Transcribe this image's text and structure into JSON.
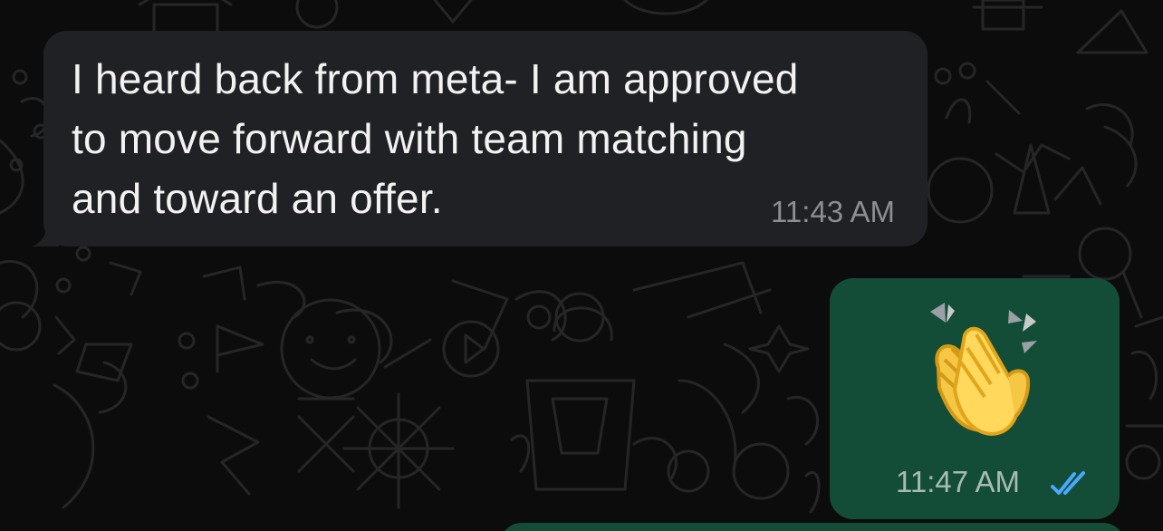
{
  "chat": {
    "messages": [
      {
        "direction": "incoming",
        "text": "I heard back from meta- I am approved\nto move forward with team matching\nand toward an offer.",
        "time": "11:43 AM"
      },
      {
        "direction": "outgoing",
        "emoji": "clapping-hands-emoji",
        "time": "11:47 AM",
        "status": "read",
        "status_icon": "double-check-icon"
      }
    ],
    "colors": {
      "background": "#0c0c0c",
      "incoming_bubble": "#202124",
      "outgoing_bubble": "#134d37",
      "incoming_text": "#f2f2f2",
      "incoming_time": "#8d8d92",
      "outgoing_time": "#a8bbb2",
      "read_receipt": "#4aa8ff"
    }
  }
}
